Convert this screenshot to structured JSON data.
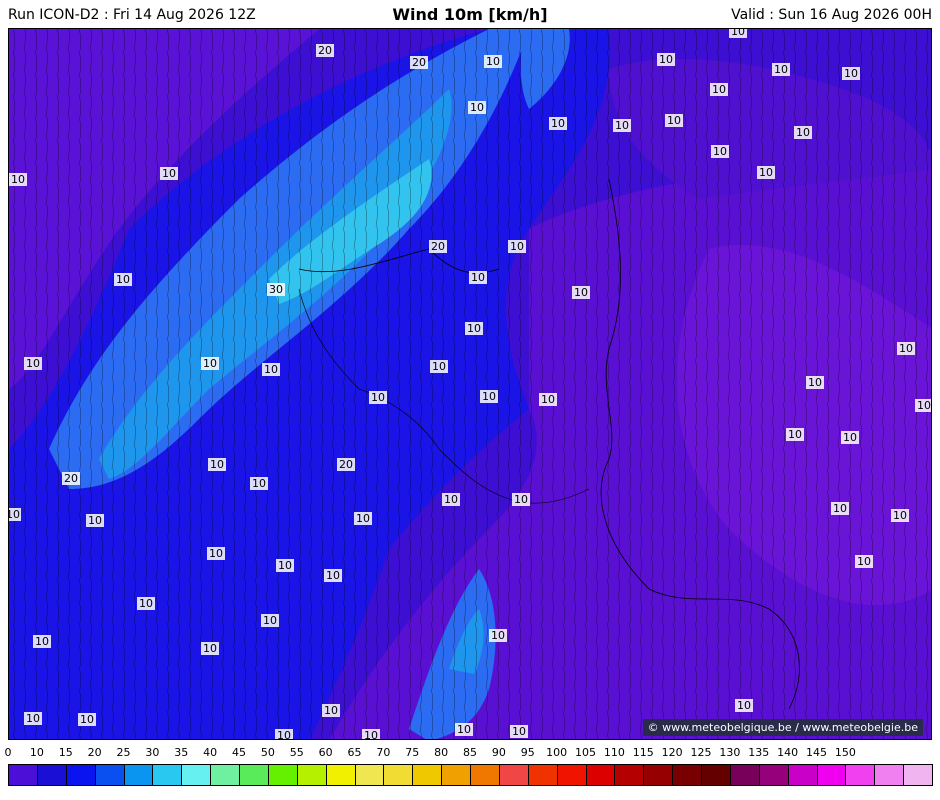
{
  "header": {
    "run": "Run ICON-D2 : Fri 14 Aug 2026 12Z",
    "title": "Wind 10m [km/h]",
    "valid": "Valid : Sun 16 Aug 2026 00H"
  },
  "map": {
    "credit": "© www.meteobelgique.be / www.meteobelgie.be",
    "contour_labels": [
      "10",
      "20",
      "30"
    ]
  },
  "legend": {
    "ticks": [
      "0",
      "10",
      "15",
      "20",
      "25",
      "30",
      "35",
      "40",
      "45",
      "50",
      "55",
      "60",
      "65",
      "70",
      "75",
      "80",
      "85",
      "90",
      "95",
      "100",
      "105",
      "110",
      "115",
      "120",
      "125",
      "130",
      "135",
      "140",
      "145",
      "150"
    ],
    "colors": [
      "#4b0fd8",
      "#1a0fd4",
      "#0a14f0",
      "#0a50f0",
      "#0a96f0",
      "#28c8f0",
      "#66f0f0",
      "#6ef0a0",
      "#5aeb5a",
      "#64f000",
      "#b4f000",
      "#f0f000",
      "#f0e650",
      "#f0dc32",
      "#f0c800",
      "#f0a000",
      "#f07800",
      "#f04646",
      "#f03200",
      "#f01400",
      "#dc0000",
      "#b40000",
      "#960000",
      "#780000",
      "#640000",
      "#78005a",
      "#96007a",
      "#c800c8",
      "#f000f0",
      "#f040f0",
      "#f080f0",
      "#f0b4f0"
    ]
  }
}
